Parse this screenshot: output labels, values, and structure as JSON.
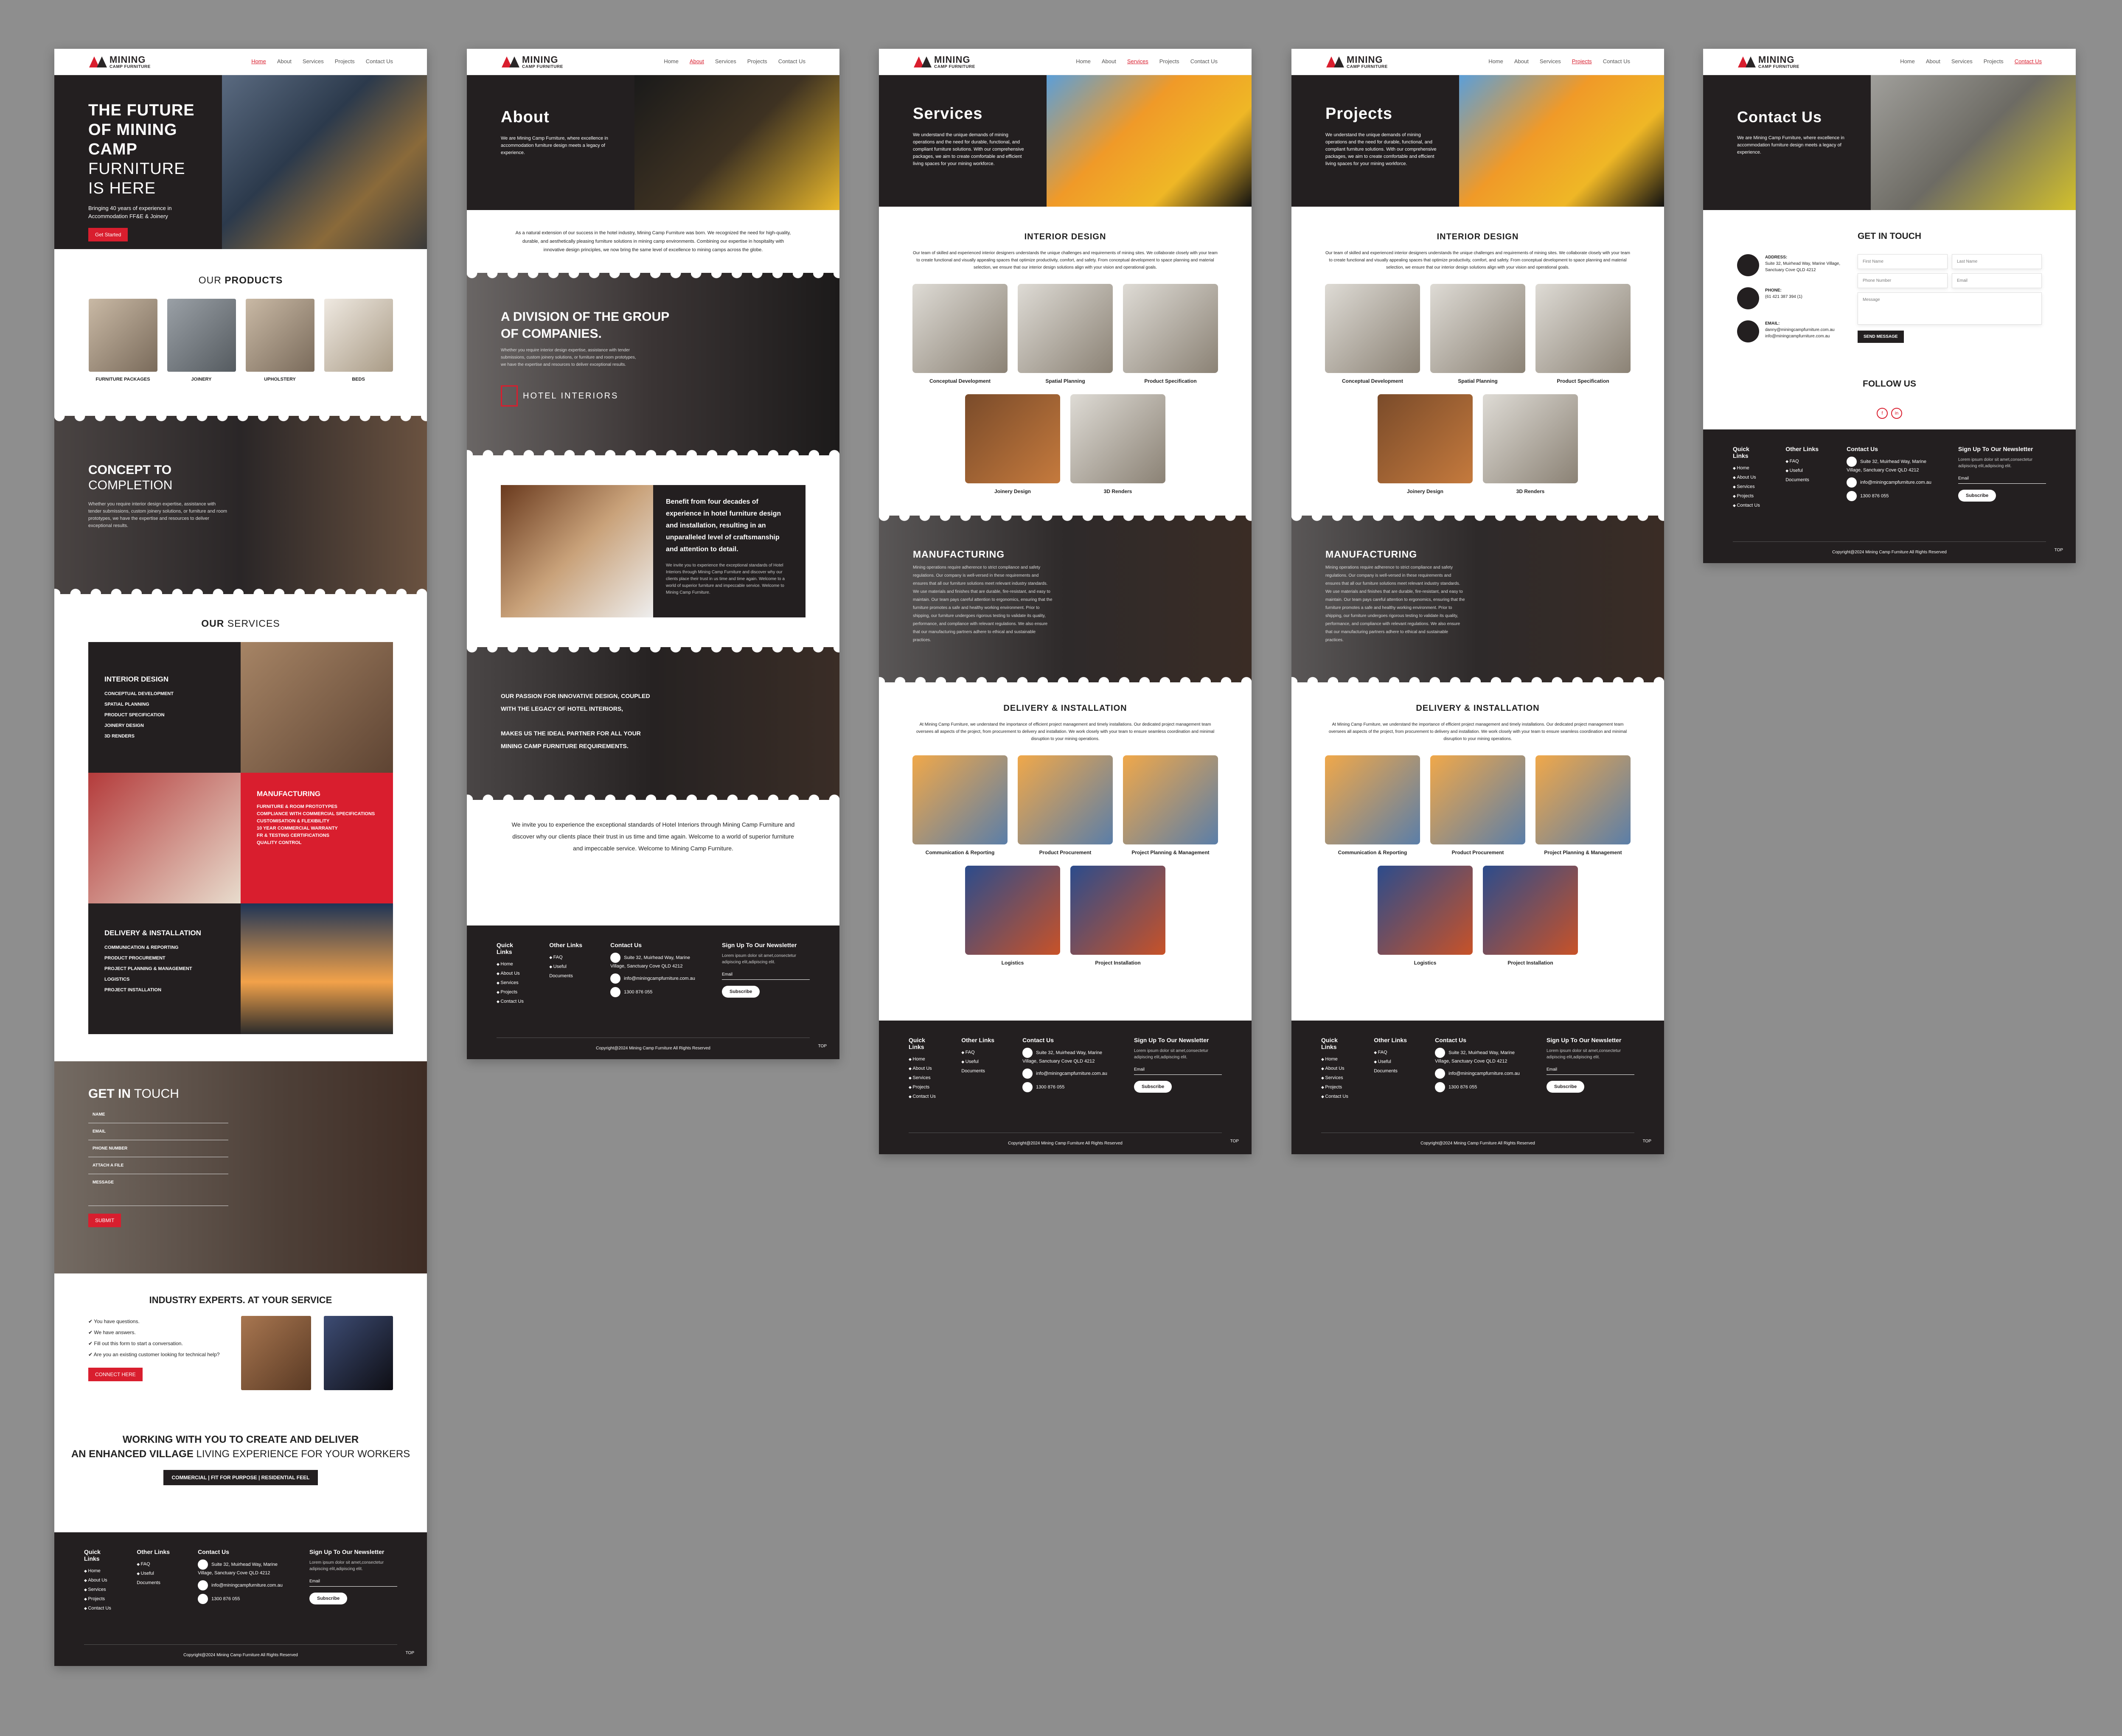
{
  "nav": {
    "logo_title": "MINING",
    "logo_sub": "CAMP FURNITURE",
    "items": [
      "Home",
      "About",
      "Services",
      "Projects",
      "Contact Us"
    ]
  },
  "home": {
    "hero_title_bold": "THE FUTURE OF MINING CAMP",
    "hero_title_light": "FURNITURE IS HERE",
    "hero_sub": "Bringing 40 years of experience in Accommodation FF&E & Joinery",
    "hero_cta": "Get Started",
    "products_title_a": "OUR",
    "products_title_b": "PRODUCTS",
    "products": [
      "FURNITURE PACKAGES",
      "JOINERY",
      "UPHOLSTERY",
      "BEDS"
    ],
    "concept_a": "CONCEPT TO",
    "concept_b": "COMPLETION",
    "concept_text": "Whether you require interior design expertise, assistance with tender submissions, custom joinery solutions, or furniture and room prototypes, we have the expertise and resources to deliver exceptional results.",
    "services_title_a": "OUR",
    "services_title_b": "SERVICES",
    "svc_interior": "INTERIOR DESIGN",
    "svc_interior_items": [
      "CONCEPTUAL DEVELOPMENT",
      "SPATIAL PLANNING",
      "PRODUCT SPECIFICATION",
      "JOINERY DESIGN",
      "3D RENDERS"
    ],
    "svc_mfg": "MANUFACTURING",
    "svc_mfg_items": [
      "FURNITURE & ROOM PROTOTYPES",
      "COMPLIANCE WITH COMMERCIAL SPECIFICATIONS",
      "CUSTOMISATION & FLEXIBILITY",
      "10 YEAR COMMERCIAL WARRANTY",
      "FR & TESTING CERTIFICATIONS",
      "QUALITY CONTROL"
    ],
    "svc_del": "DELIVERY & INSTALLATION",
    "svc_del_items": [
      "COMMUNICATION & REPORTING",
      "PRODUCT PROCUREMENT",
      "PROJECT PLANNING & MANAGEMENT",
      "LOGISTICS",
      "PROJECT INSTALLATION"
    ],
    "git_a": "GET IN",
    "git_b": "TOUCH",
    "form": [
      "NAME",
      "EMAIL",
      "PHONE NUMBER",
      "ATTACH A FILE",
      "MESSAGE"
    ],
    "submit": "SUBMIT",
    "experts_a": "INDUSTRY EXPERTS.",
    "experts_b": "AT YOUR SERVICE",
    "experts_list": [
      "You have questions.",
      "We have answers.",
      "Fill out this form to start a conversation.",
      "Are you an existing customer looking for technical help?"
    ],
    "connect": "CONNECT HERE",
    "working_a": "WORKING WITH YOU TO CREATE AND DELIVER",
    "working_b": "AN ENHANCED VILLAGE",
    "working_c": "LIVING EXPERIENCE FOR YOUR WORKERS",
    "tagbar": "COMMERCIAL | FIT FOR PURPOSE | RESIDENTIAL FEEL"
  },
  "about": {
    "title": "About",
    "hero_text": "We are Mining Camp Furniture, where excellence in accommodation furniture design meets a legacy of experience.",
    "intro": "As a natural extension of our success in the hotel industry, Mining Camp Furniture was born. We recognized the need for high-quality, durable, and aesthetically pleasing furniture solutions in mining camp environments. Combining our expertise in hospitality with innovative design principles, we now bring the same level of excellence to mining camps across the globe.",
    "division": "A DIVISION OF THE GROUP OF COMPANIES.",
    "division_text": "Whether you require interior design expertise, assistance with tender submissions, custom joinery solutions, or furniture and room prototypes, we have the expertise and resources to deliver exceptional results.",
    "hotel_logo": "HOTEL INTERIORS",
    "benefit_title": "Benefit from four decades of experience in hotel furniture design and installation, resulting in an unparalleled level of craftsmanship and attention to detail.",
    "benefit_text": "We invite you to experience the exceptional standards of Hotel Interiors through Mining Camp Furniture and discover why our clients place their trust in us time and time again. Welcome to a world of superior furniture and impeccable service. Welcome to Mining Camp Furniture.",
    "passion_a": "OUR PASSION FOR INNOVATIVE DESIGN, COUPLED WITH THE LEGACY OF HOTEL INTERIORS,",
    "passion_b": "MAKES US THE IDEAL PARTNER FOR ALL YOUR MINING CAMP FURNITURE REQUIREMENTS.",
    "invite": "We invite you to experience the exceptional standards of Hotel Interiors through Mining Camp Furniture and discover why our clients place their trust in us time and time again. Welcome to a world of superior furniture and impeccable service. Welcome to Mining Camp Furniture."
  },
  "services": {
    "title": "Services",
    "projects_title": "Projects",
    "hero_text": "We understand the unique demands of mining operations and the need for durable, functional, and compliant furniture solutions. With our comprehensive packages, we aim to create comfortable and efficient living spaces for your mining workforce.",
    "interior_title": "INTERIOR DESIGN",
    "interior_text": "Our team of skilled and experienced interior designers understands the unique challenges and requirements of mining sites. We collaborate closely with your team to create functional and visually appealing spaces that optimize productivity, comfort, and safety. From conceptual development to space planning and material selection, we ensure that our interior design solutions align with your vision and operational goals.",
    "interior_items": [
      "Conceptual Development",
      "Spatial Planning",
      "Product Specification",
      "Joinery Design",
      "3D Renders"
    ],
    "mfg_title": "MANUFACTURING",
    "mfg_text": "Mining operations require adherence to strict compliance and safety regulations. Our company is well-versed in these requirements and ensures that all our furniture solutions meet relevant industry standards. We use materials and finishes that are durable, fire-resistant, and easy to maintain. Our team pays careful attention to ergonomics, ensuring that the furniture promotes a safe and healthy working environment. Prior to shipping, our furniture undergoes rigorous testing to validate its quality, performance, and compliance with relevant regulations. We also ensure that our manufacturing partners adhere to ethical and sustainable practices.",
    "del_title": "DELIVERY & INSTALLATION",
    "del_text": "At Mining Camp Furniture, we understand the importance of efficient project management and timely installations. Our dedicated project management team oversees all aspects of the project, from procurement to delivery and installation. We work closely with your team to ensure seamless coordination and minimal disruption to your mining operations.",
    "del_items": [
      "Communication & Reporting",
      "Product Procurement",
      "Project Planning & Management",
      "Logistics",
      "Project Installation"
    ]
  },
  "contact": {
    "title": "Contact Us",
    "hero_text": "We are Mining Camp Furniture, where excellence in accommodation furniture design meets a legacy of experience.",
    "git": "GET IN TOUCH",
    "address_label": "ADDRESS:",
    "address": "Suite 32, Muirhead Way, Marine Village, Sanctuary Cove QLD 4212",
    "phone_label": "PHONE:",
    "phone": "(61 421 387 394 (1)",
    "email_label": "EMAIL:",
    "email": "danny@miningcampfurniture.com.au info@miningcampfurniture.com.au",
    "fields": [
      "First Name",
      "Last Name",
      "Phone Number",
      "Email",
      "Message"
    ],
    "send": "SEND MESSAGE",
    "follow": "FOLLOW US",
    "social": [
      "f",
      "in"
    ]
  },
  "footer": {
    "quick_title": "Quick Links",
    "quick": [
      "Home",
      "About Us",
      "Services",
      "Projects",
      "Contact Us"
    ],
    "other_title": "Other Links",
    "other": [
      "FAQ",
      "Useful Documents"
    ],
    "contact_title": "Contact Us",
    "address": "Suite 32, Muirhead Way, Marine Village, Sanctuary Cove QLD 4212",
    "email": "info@miningcampfurniture.com.au",
    "phone": "1300 876 055",
    "news_title": "Sign Up To Our Newsletter",
    "news_text": "Lorem ipsum dolor sit amet,consectetur adipiscing elit,adipiscing elit.",
    "email_placeholder": "Email",
    "subscribe": "Subscribe",
    "copyright": "Copyright@2024 Mining Camp Furniture All Rights Reserved",
    "top": "TOP"
  },
  "colors": {
    "brand_red": "#d91e2e",
    "brand_dark": "#231f20"
  }
}
